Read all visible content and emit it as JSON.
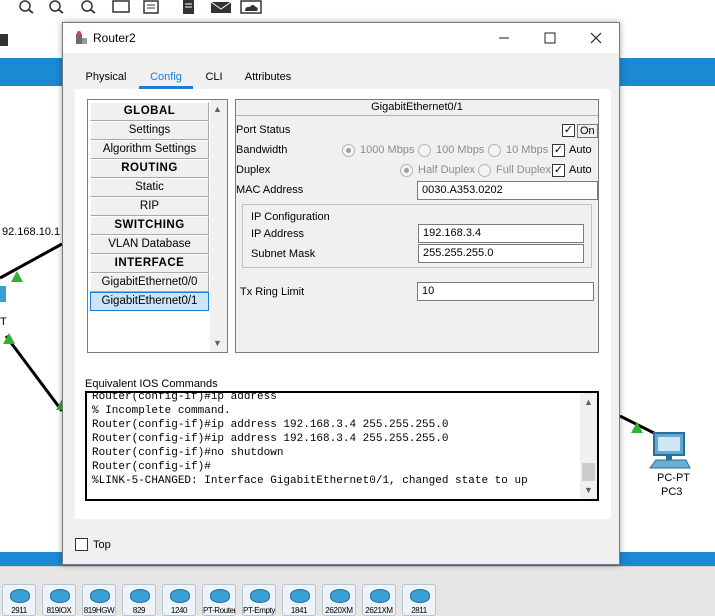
{
  "workspace": {
    "left_label": "92.168.10.1",
    "left_t": "T",
    "pc_model": "PC-PT",
    "pc_name": "PC3",
    "device_tiles": [
      "2911",
      "819IOX",
      "819HGW",
      "829",
      "1240",
      "PT-Router",
      "PT-Empty",
      "1841",
      "2620XM",
      "2621XM",
      "2811"
    ]
  },
  "window": {
    "title": "Router2",
    "tabs": [
      {
        "label": "Physical",
        "active": false
      },
      {
        "label": "Config",
        "active": true
      },
      {
        "label": "CLI",
        "active": false
      },
      {
        "label": "Attributes",
        "active": false
      }
    ]
  },
  "nav": {
    "items": [
      {
        "label": "GLOBAL",
        "header": true
      },
      {
        "label": "Settings",
        "header": false
      },
      {
        "label": "Algorithm Settings",
        "header": false
      },
      {
        "label": "ROUTING",
        "header": true
      },
      {
        "label": "Static",
        "header": false
      },
      {
        "label": "RIP",
        "header": false
      },
      {
        "label": "SWITCHING",
        "header": true
      },
      {
        "label": "VLAN Database",
        "header": false
      },
      {
        "label": "INTERFACE",
        "header": true
      },
      {
        "label": "GigabitEthernet0/0",
        "header": false
      },
      {
        "label": "GigabitEthernet0/1",
        "header": false,
        "selected": true
      }
    ]
  },
  "interface": {
    "title": "GigabitEthernet0/1",
    "port_status_label": "Port Status",
    "port_status_on_label": "On",
    "port_status_on": true,
    "bandwidth_label": "Bandwidth",
    "bandwidth_options": [
      "1000 Mbps",
      "100 Mbps",
      "10 Mbps"
    ],
    "bandwidth_auto_label": "Auto",
    "duplex_label": "Duplex",
    "duplex_options": [
      "Half Duplex",
      "Full Duplex"
    ],
    "duplex_auto_label": "Auto",
    "mac_label": "MAC Address",
    "mac_value": "0030.A353.0202",
    "ip_config_label": "IP Configuration",
    "ip_label": "IP Address",
    "ip_value": "192.168.3.4",
    "mask_label": "Subnet Mask",
    "mask_value": "255.255.255.0",
    "tx_label": "Tx Ring Limit",
    "tx_value": "10"
  },
  "ios": {
    "label": "Equivalent IOS Commands",
    "lines": [
      "Router(config-if)#ip address",
      "% Incomplete command.",
      "Router(config-if)#ip address 192.168.3.4 255.255.255.0",
      "Router(config-if)#ip address 192.168.3.4 255.255.255.0",
      "Router(config-if)#no shutdown",
      "Router(config-if)#",
      "%LINK-5-CHANGED: Interface GigabitEthernet0/1, changed state to up"
    ]
  },
  "bottom": {
    "top_label": "Top"
  },
  "colors": {
    "accent": "#1d7cd6",
    "band": "#1a8ad4"
  }
}
